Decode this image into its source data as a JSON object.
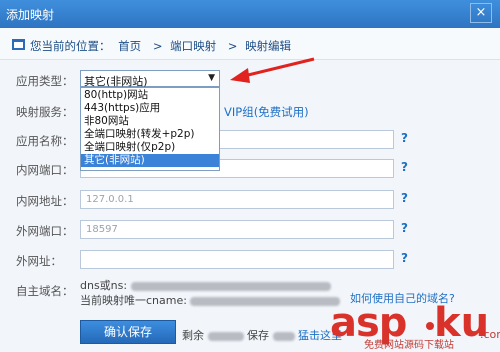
{
  "window": {
    "title": "添加映射",
    "close_label": "×"
  },
  "breadcrumb": {
    "prefix": "您当前的位置：",
    "items": [
      "首页",
      "端口映射",
      "映射编辑"
    ],
    "separator": ">"
  },
  "form": {
    "app_type": {
      "label": "应用类型：",
      "value": "其它(非网站)",
      "arrow": "▼",
      "options": [
        "80(http)网站",
        "443(https)应用",
        "非80网站",
        "全端口映射(转发+p2p)",
        "全端口映射(仅p2p)",
        "其它(非网站)"
      ],
      "selected_index": 5
    },
    "mapping_service": {
      "label": "映射服务：",
      "vip_text": "VIP组(免费试用)"
    },
    "app_name": {
      "label": "应用名称：",
      "value": ""
    },
    "internal_port": {
      "label": "内网端口：",
      "value": ""
    },
    "internal_addr": {
      "label": "内网地址：",
      "value": "127.0.0.1"
    },
    "external_port": {
      "label": "外网端口：",
      "value": "18597"
    },
    "external_addr": {
      "label": "外网址：",
      "value": ""
    },
    "domain": {
      "label": "自主域名：",
      "line1": "dns或ns:",
      "line2": "当前映射唯一cname:",
      "help_link": "如何使用自己的域名?"
    },
    "help_mark": "?"
  },
  "footer": {
    "save_label": "确认保存",
    "remain_prefix": "剩余",
    "save_text": "保存",
    "link_text": "猛击这里"
  },
  "watermark": {
    "big": "asp",
    "ku": "ku",
    "com": ".com",
    "sub": "免费网站源码下载站"
  }
}
